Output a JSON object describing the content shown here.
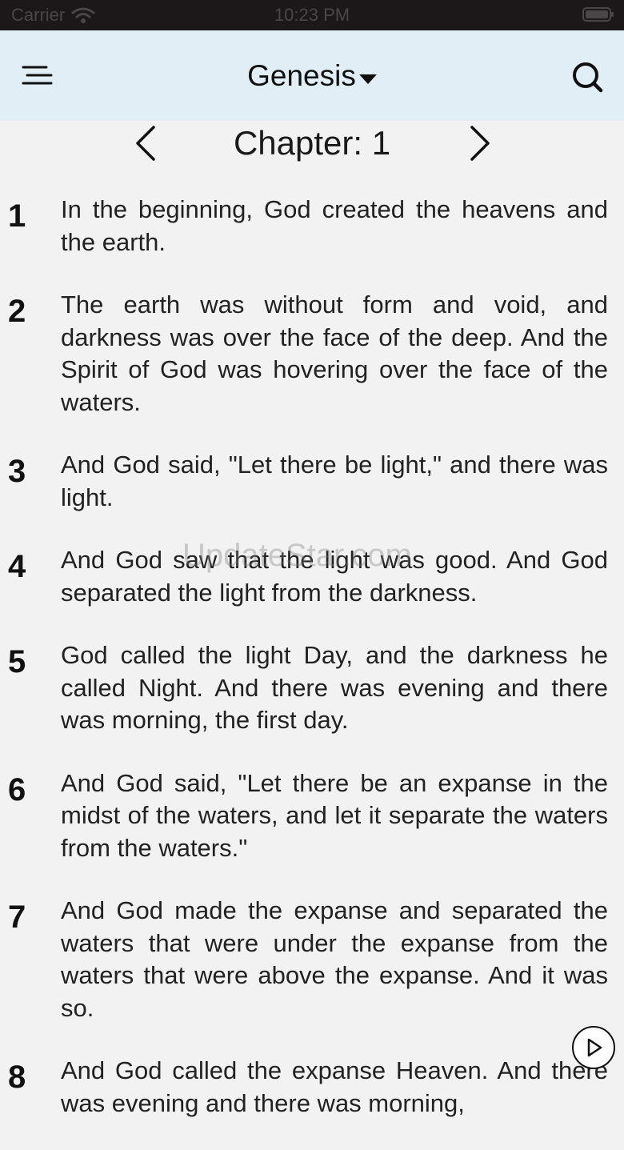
{
  "status_bar": {
    "carrier": "Carrier",
    "time": "10:23 PM"
  },
  "header": {
    "book_title": "Genesis",
    "icons": {
      "menu": "menu-lines-icon",
      "search": "search-icon",
      "dropdown": "caret-down-icon"
    }
  },
  "chapter_nav": {
    "label": "Chapter: 1",
    "prev_icon": "chevron-left-icon",
    "next_icon": "chevron-right-icon"
  },
  "verses": [
    {
      "number": "1",
      "text": "In the beginning, God created the heavens and the earth."
    },
    {
      "number": "2",
      "text": "The earth was without form and void, and darkness was over the face of the deep. And the Spirit of God was hovering over the face of the waters."
    },
    {
      "number": "3",
      "text": "And God said, \"Let there be light,\" and there was light."
    },
    {
      "number": "4",
      "text": "And God saw that the light was good. And God separated the light from the darkness."
    },
    {
      "number": "5",
      "text": "God called the light Day, and the darkness he called Night. And there was evening and there was morning, the first day."
    },
    {
      "number": "6",
      "text": "And God said, \"Let there be an expanse in the midst of the waters, and let it separate the waters from the waters.\""
    },
    {
      "number": "7",
      "text": "And God made the expanse and separated the waters that were under the expanse from the waters that were above the expanse. And it was so."
    },
    {
      "number": "8",
      "text": "And God called the expanse Heaven. And there was evening and there was morning,"
    }
  ],
  "watermark": "UpdateStar.com",
  "colors": {
    "header_bg": "#e1eef6",
    "page_bg": "#f2f2f2",
    "status_bg": "#1c1718"
  }
}
